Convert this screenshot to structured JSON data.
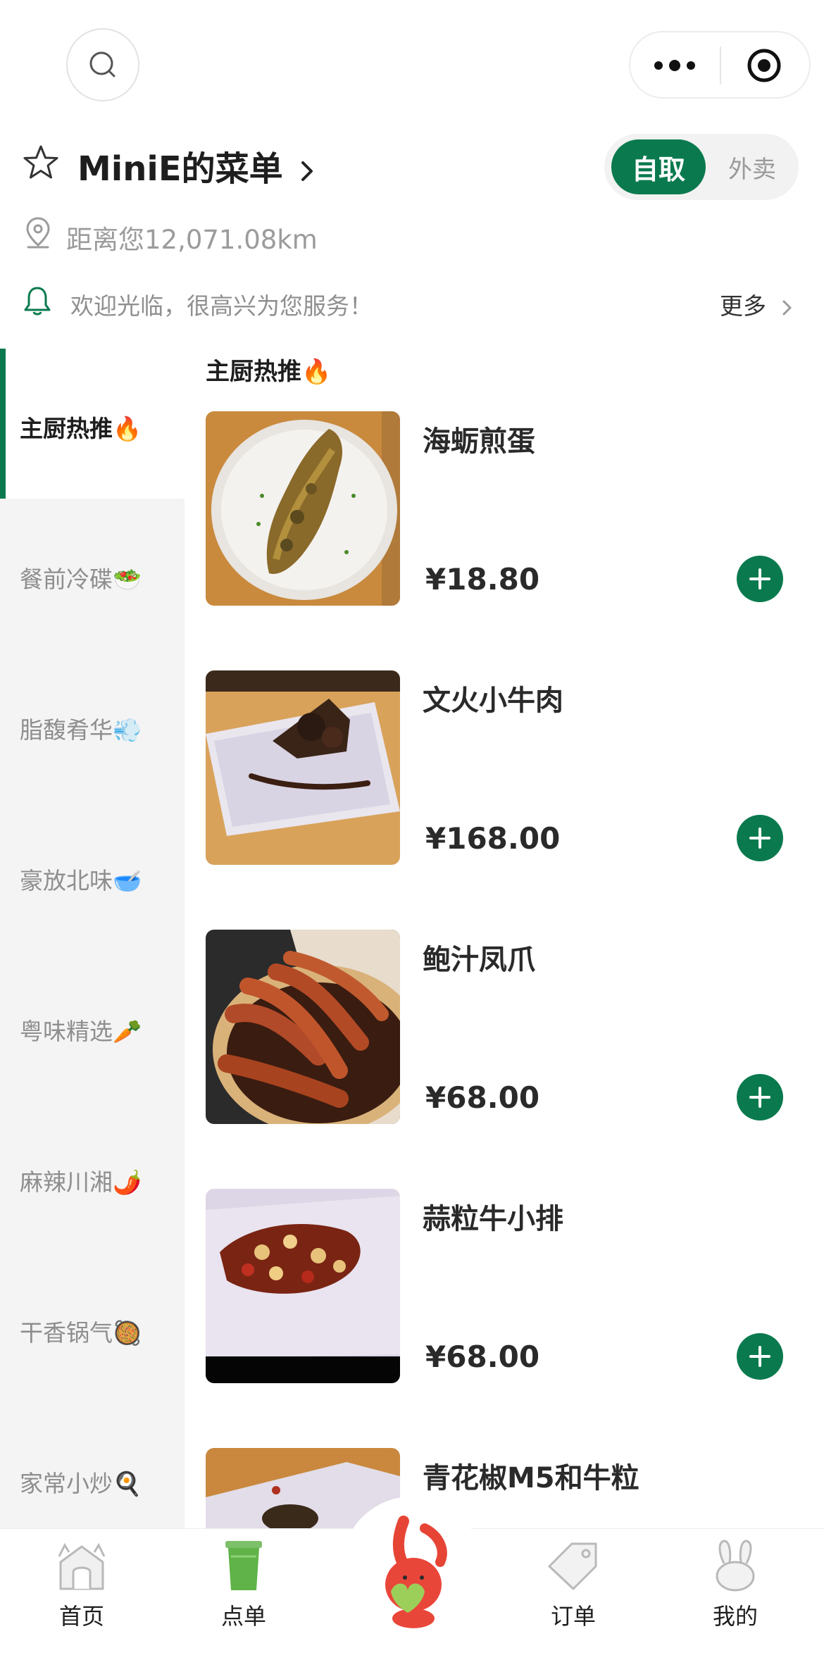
{
  "header": {
    "search_icon": "search-icon",
    "more_icon": "more-dots-icon",
    "close_icon": "target-close-icon"
  },
  "store": {
    "name": "MiniE的菜单",
    "mode_active": "自取",
    "mode_inactive": "外卖",
    "distance": "距离您12,071.08km",
    "notice": "欢迎光临，很高兴为您服务！",
    "more": "更多"
  },
  "sidebar": {
    "items": [
      {
        "label": "主厨热推",
        "emoji": "🔥",
        "active": true
      },
      {
        "label": "餐前冷碟",
        "emoji": "🥗",
        "active": false
      },
      {
        "label": "脂馥肴华",
        "emoji": "💨",
        "active": false
      },
      {
        "label": "豪放北味",
        "emoji": "🥣",
        "active": false
      },
      {
        "label": "粤味精选",
        "emoji": "🥕",
        "active": false
      },
      {
        "label": "麻辣川湘",
        "emoji": "🌶️",
        "active": false
      },
      {
        "label": "干香锅气",
        "emoji": "🥘",
        "active": false
      },
      {
        "label": "家常小炒",
        "emoji": "🍳",
        "active": false
      }
    ]
  },
  "section": {
    "title": "主厨热推",
    "emoji": "🔥"
  },
  "dishes": [
    {
      "name": "海蛎煎蛋",
      "price": "¥18.80"
    },
    {
      "name": "文火小牛肉",
      "price": "¥168.00"
    },
    {
      "name": "鲍汁凤爪",
      "price": "¥68.00"
    },
    {
      "name": "蒜粒牛小排",
      "price": "¥68.00"
    },
    {
      "name": "青花椒M5和牛粒",
      "price": ""
    }
  ],
  "tabbar": {
    "items": [
      {
        "label": "首页",
        "icon": "home-icon"
      },
      {
        "label": "点单",
        "icon": "cup-icon"
      },
      {
        "label": "",
        "icon": "mascot-bunny-icon"
      },
      {
        "label": "订单",
        "icon": "tag-icon"
      },
      {
        "label": "我的",
        "icon": "bunny-icon"
      }
    ]
  },
  "colors": {
    "accent": "#0a7a4e"
  }
}
